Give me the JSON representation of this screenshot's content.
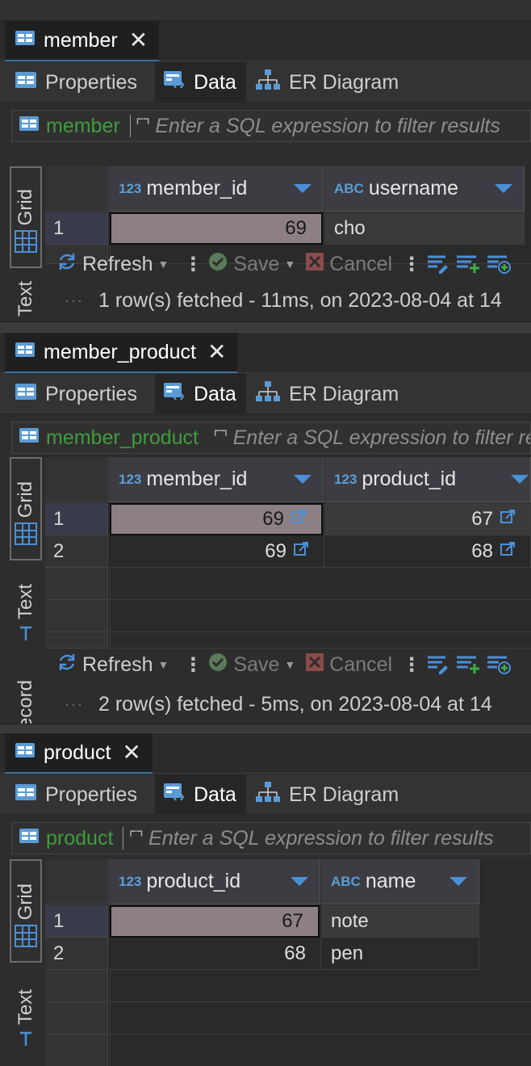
{
  "panels": [
    {
      "tab_title": "member",
      "sub_tabs": [
        "Properties",
        "Data",
        "ER Diagram"
      ],
      "filter": {
        "entity": "member",
        "placeholder": "Enter a SQL expression to filter results"
      },
      "side_tabs": [
        "Grid",
        "Text"
      ],
      "columns": [
        {
          "type": "123",
          "name": "member_id"
        },
        {
          "type": "ABC",
          "name": "username"
        }
      ],
      "rows": [
        {
          "num": "1",
          "cells": [
            "69",
            "cho"
          ]
        }
      ],
      "toolbar": {
        "refresh": "Refresh",
        "save": "Save",
        "cancel": "Cancel"
      },
      "status": "1 row(s) fetched - 11ms, on 2023-08-04 at 14"
    },
    {
      "tab_title": "member_product",
      "sub_tabs": [
        "Properties",
        "Data",
        "ER Diagram"
      ],
      "filter": {
        "entity": "member_product",
        "placeholder": "Enter a SQL expression to filter results"
      },
      "side_tabs": [
        "Grid",
        "Text",
        "Record"
      ],
      "columns": [
        {
          "type": "123",
          "name": "member_id"
        },
        {
          "type": "123",
          "name": "product_id"
        }
      ],
      "rows": [
        {
          "num": "1",
          "cells": [
            "69",
            "67"
          ]
        },
        {
          "num": "2",
          "cells": [
            "69",
            "68"
          ]
        }
      ],
      "toolbar": {
        "refresh": "Refresh",
        "save": "Save",
        "cancel": "Cancel"
      },
      "status": "2 row(s) fetched - 5ms, on 2023-08-04 at 14"
    },
    {
      "tab_title": "product",
      "sub_tabs": [
        "Properties",
        "Data",
        "ER Diagram"
      ],
      "filter": {
        "entity": "product",
        "placeholder": "Enter a SQL expression to filter results"
      },
      "side_tabs": [
        "Grid",
        "Text"
      ],
      "columns": [
        {
          "type": "123",
          "name": "product_id"
        },
        {
          "type": "ABC",
          "name": "name"
        }
      ],
      "rows": [
        {
          "num": "1",
          "cells": [
            "67",
            "note"
          ]
        },
        {
          "num": "2",
          "cells": [
            "68",
            "pen"
          ]
        }
      ]
    }
  ],
  "colors": {
    "accent": "#4a90d9",
    "entity_green": "#3f9c3f",
    "focused_cell": "#8d7f86",
    "header_bg": "#3c3c42"
  },
  "icons": {
    "table": "table-icon",
    "close": "close-icon",
    "properties": "properties-icon",
    "data": "data-icon",
    "er_diagram": "er-diagram-icon",
    "grid": "grid-icon",
    "text": "text-icon",
    "refresh": "refresh-icon",
    "save": "check-circle-icon",
    "cancel": "cancel-icon",
    "link": "external-link-icon"
  }
}
